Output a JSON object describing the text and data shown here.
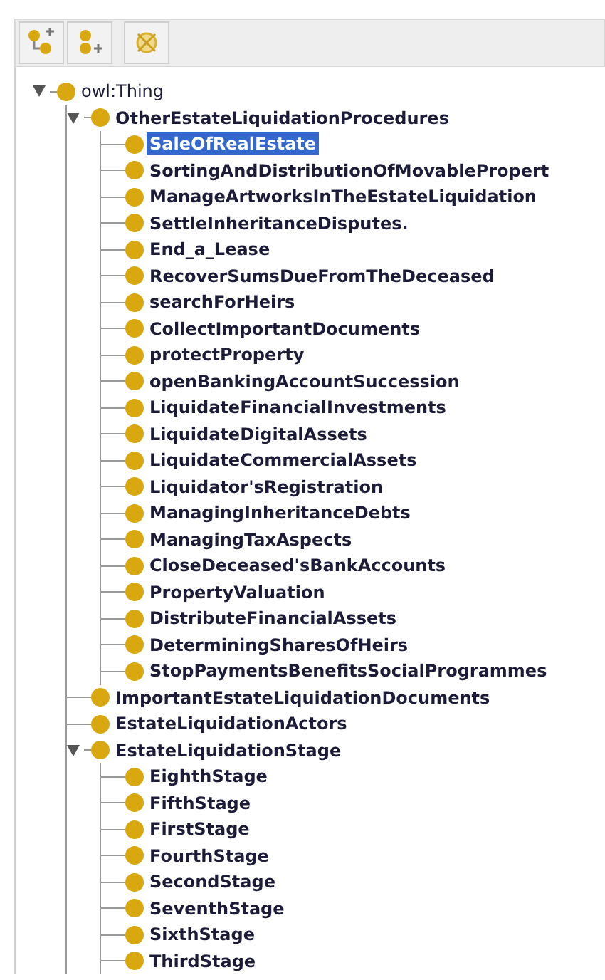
{
  "tree": [
    {
      "label": "owl:Thing",
      "expanded": true,
      "selected": false,
      "children": [
        {
          "label": "OtherEstateLiquidationProcedures",
          "expanded": true,
          "selected": false,
          "children": [
            {
              "label": "SaleOfRealEstate",
              "selected": true
            },
            {
              "label": "SortingAndDistributionOfMovablePropert",
              "selected": false
            },
            {
              "label": "ManageArtworksInTheEstateLiquidation",
              "selected": false
            },
            {
              "label": "SettleInheritanceDisputes.",
              "selected": false
            },
            {
              "label": "End_a_Lease",
              "selected": false
            },
            {
              "label": "RecoverSumsDueFromTheDeceased",
              "selected": false
            },
            {
              "label": "searchForHeirs",
              "selected": false
            },
            {
              "label": "CollectImportantDocuments",
              "selected": false
            },
            {
              "label": "protectProperty",
              "selected": false
            },
            {
              "label": "openBankingAccountSuccession",
              "selected": false
            },
            {
              "label": "LiquidateFinancialInvestments",
              "selected": false
            },
            {
              "label": "LiquidateDigitalAssets",
              "selected": false
            },
            {
              "label": "LiquidateCommercialAssets",
              "selected": false
            },
            {
              "label": "Liquidator'sRegistration",
              "selected": false
            },
            {
              "label": "ManagingInheritanceDebts",
              "selected": false
            },
            {
              "label": "ManagingTaxAspects",
              "selected": false
            },
            {
              "label": "CloseDeceased'sBankAccounts",
              "selected": false
            },
            {
              "label": "PropertyValuation",
              "selected": false
            },
            {
              "label": "DistributeFinancialAssets",
              "selected": false
            },
            {
              "label": "DeterminingSharesOfHeirs",
              "selected": false
            },
            {
              "label": "StopPaymentsBenefitsSocialProgrammes",
              "selected": false
            }
          ]
        },
        {
          "label": "ImportantEstateLiquidationDocuments",
          "selected": false
        },
        {
          "label": "EstateLiquidationActors",
          "selected": false
        },
        {
          "label": "EstateLiquidationStage",
          "expanded": true,
          "selected": false,
          "children": [
            {
              "label": "EighthStage",
              "selected": false
            },
            {
              "label": "FifthStage",
              "selected": false
            },
            {
              "label": "FirstStage",
              "selected": false
            },
            {
              "label": "FourthStage",
              "selected": false
            },
            {
              "label": "SecondStage",
              "selected": false
            },
            {
              "label": "SeventhStage",
              "selected": false
            },
            {
              "label": "SixthStage",
              "selected": false
            },
            {
              "label": "ThirdStage",
              "selected": false
            }
          ]
        }
      ]
    }
  ]
}
